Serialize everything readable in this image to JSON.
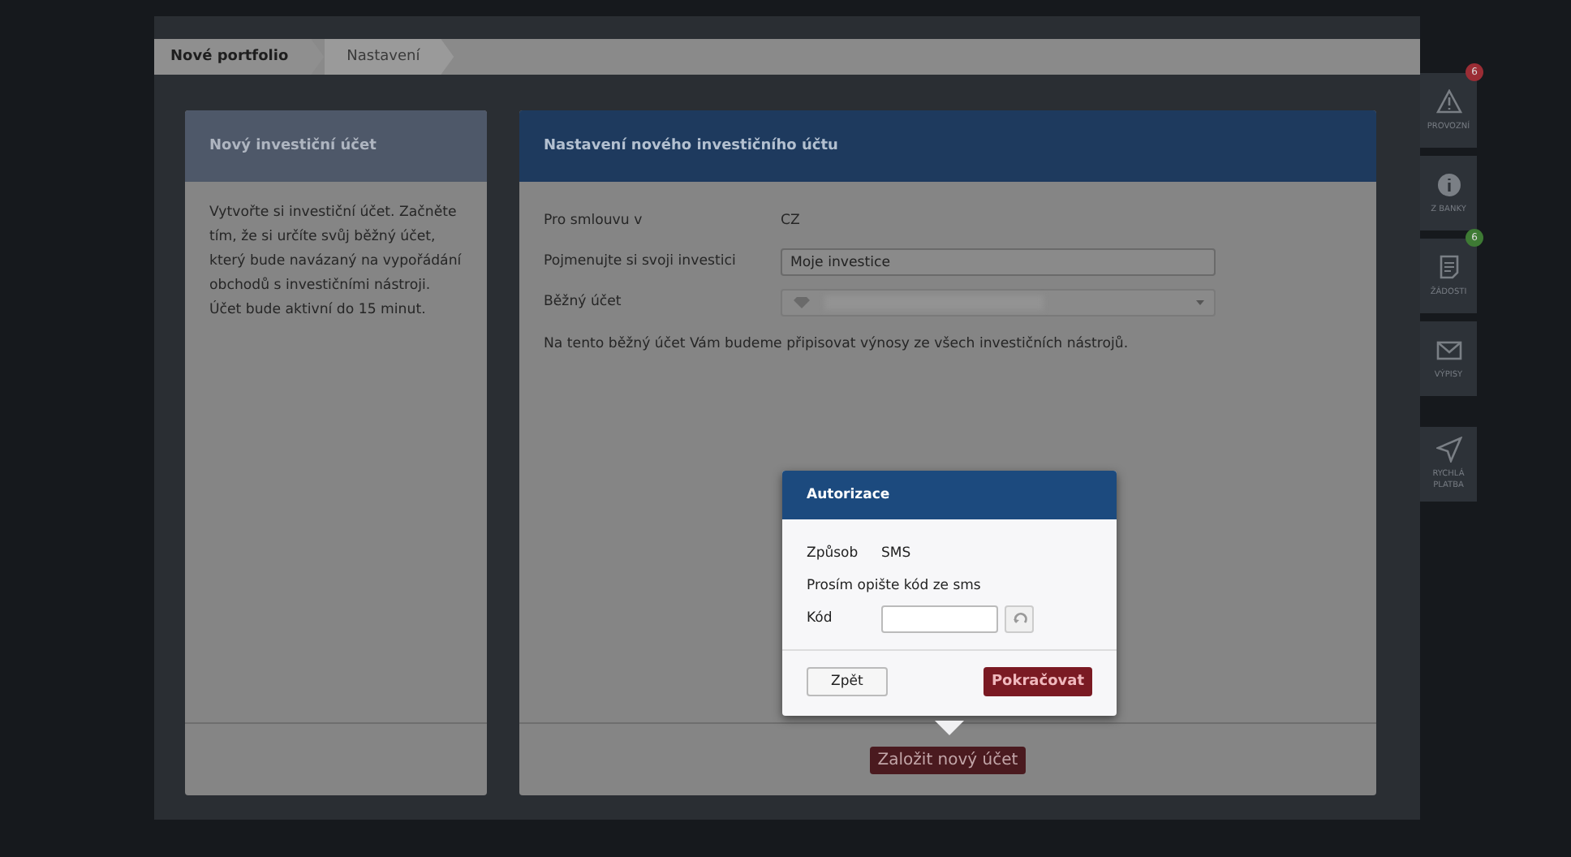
{
  "breadcrumbs": [
    {
      "label": "Nové portfolio",
      "selected": true
    },
    {
      "label": "Nastavení",
      "selected": false
    }
  ],
  "info_panel": {
    "title": "Nový investiční účet",
    "text": "Vytvořte si investiční účet. Začněte tím, že si určíte svůj běžný účet, který bude navázaný na vypořádání obchodů s investičními nástroji. Účet bude aktivní do 15 minut."
  },
  "form_panel": {
    "title": "Nastavení nového investičního účtu",
    "fields": [
      {
        "kind": "text",
        "label": "Pro smlouvu v",
        "value": "CZ"
      },
      {
        "kind": "input",
        "label": "Pojmenujte si svoji investici",
        "value": "Moje investice"
      },
      {
        "kind": "select",
        "label": "Běžný účet"
      }
    ],
    "note": "Na tento běžný účet Vám budeme připisovat výnosy ze všech investičních nástrojů.",
    "submit": "Založit nový účet"
  },
  "dialog": {
    "title": "Autorizace",
    "method_label": "Způsob",
    "method": "SMS",
    "prompt": "Prosím opište kód ze sms",
    "code_label": "Kód",
    "back": "Zpět",
    "continue": "Pokračovat"
  },
  "side_menu": [
    {
      "kind": "warning",
      "label": "PROVOZNÍ",
      "badge": "6",
      "color": "#9b2d35"
    },
    {
      "kind": "info",
      "label": "Z BANKY"
    },
    {
      "kind": "document",
      "label": "ŽÁDOSTI",
      "badge": "6",
      "color": "#3e7a34"
    },
    {
      "kind": "mail",
      "label": "VÝPISY"
    }
  ],
  "quick_action": {
    "kind": "send",
    "label": "RYCHLÁ PLATBA"
  }
}
